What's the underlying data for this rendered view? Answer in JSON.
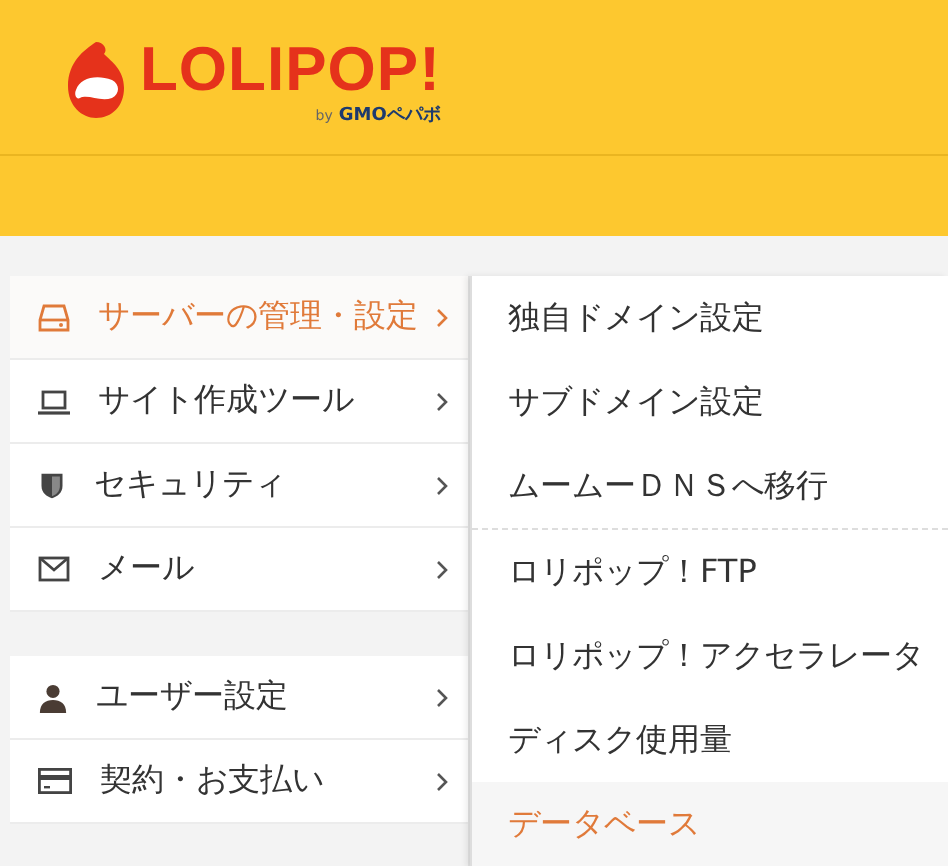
{
  "logo": {
    "name": "LOLIPOP!",
    "byline_prefix": "by",
    "byline": "GMOペパボ"
  },
  "menu_groups": [
    {
      "items": [
        {
          "label": "サーバーの管理・設定",
          "kind": "server",
          "selected": true
        },
        {
          "label": "サイト作成ツール",
          "kind": "laptop",
          "selected": false
        },
        {
          "label": "セキュリティ",
          "kind": "shield",
          "selected": false
        },
        {
          "label": "メール",
          "kind": "mail",
          "selected": false
        }
      ]
    },
    {
      "items": [
        {
          "label": "ユーザー設定",
          "kind": "user",
          "selected": false
        },
        {
          "label": "契約・お支払い",
          "kind": "card",
          "selected": false
        }
      ]
    }
  ],
  "submenu": [
    {
      "label": "独自ドメイン設定",
      "selected": false,
      "divider_after": false
    },
    {
      "label": "サブドメイン設定",
      "selected": false,
      "divider_after": false
    },
    {
      "label": "ムームーＤＮＳへ移行",
      "selected": false,
      "divider_after": true
    },
    {
      "label": "ロリポップ！FTP",
      "selected": false,
      "divider_after": false
    },
    {
      "label": "ロリポップ！アクセラレータ",
      "selected": false,
      "divider_after": false
    },
    {
      "label": "ディスク使用量",
      "selected": false,
      "divider_after": false
    },
    {
      "label": "データベース",
      "selected": true,
      "divider_after": false
    }
  ]
}
